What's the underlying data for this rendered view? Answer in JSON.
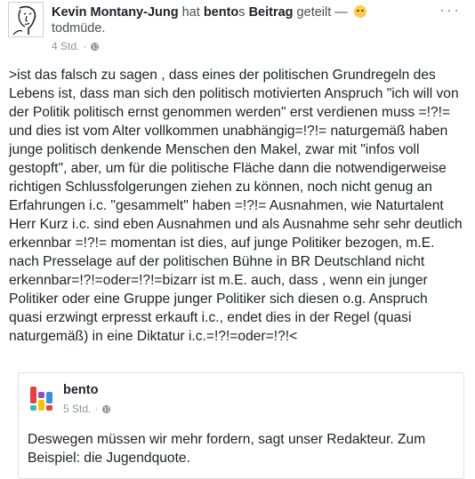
{
  "post": {
    "author": "Kevin Montany-Jung",
    "verb": " hat ",
    "page": "bento",
    "possessive": "s ",
    "object": "Beitrag",
    "action": " geteilt — ",
    "feeling_icon": "sleepy-face-emoji",
    "feeling": "todmüde.",
    "time": "4 Std.",
    "privacy_separator": "·",
    "privacy_icon": "globe-icon",
    "menu_icon": "more-options-icon",
    "menu_label": "···",
    "text": ">ist das falsch zu sagen , dass eines der politischen Grundregeln des Lebens ist, dass man sich den politisch motivierten Anspruch \"ich will von der Politik politisch ernst genommen werden\" erst verdienen muss =!?!= und dies ist vom Alter vollkommen unabhängig=!?!= naturgemäß haben junge politisch denkende Menschen den Makel, zwar mit \"infos voll gestopft\", aber, um für die politische Fläche dann die notwendigerweise richtigen Schlussfolgerungen ziehen zu können, noch nicht genug an Erfahrungen i.c. \"gesammelt\" haben =!?!= Ausnahmen,  wie Naturtalent Herr Kurz i.c. sind eben Ausnahmen und als Ausnahme sehr sehr deutlich erkennbar =!?!=  momentan ist dies,  auf junge Politiker bezogen, m.E. nach Presselage auf der politischen Bühne in BR Deutschland nicht erkennbar=!?!=oder=!?!=bizarr ist m.E. auch,  dass , wenn ein junger Politiker oder eine Gruppe junger Politiker sich diesen o.g. Anspruch quasi erzwingt erpresst erkauft i.c., endet dies in der Regel (quasi naturgemäß) in eine Diktatur i.c.=!?!=oder=!?!<"
  },
  "shared": {
    "page_name": "bento",
    "time": "5 Std.",
    "privacy_separator": "·",
    "privacy_icon": "globe-icon",
    "logo_icon": "bento-logo-icon",
    "text": "Deswegen müssen wir mehr fordern, sagt unser Redakteur. Zum Beispiel: die Jugendquote."
  },
  "colors": {
    "text": "#1d2129",
    "meta": "#90949c",
    "border": "#dddfe2",
    "logo_red": "#e8413c",
    "logo_blue": "#3b8ee0",
    "logo_yellow": "#f7c300",
    "logo_purple": "#8d4fc2",
    "logo_teal": "#2ebfb4",
    "emoji": "#ffcc4d"
  }
}
